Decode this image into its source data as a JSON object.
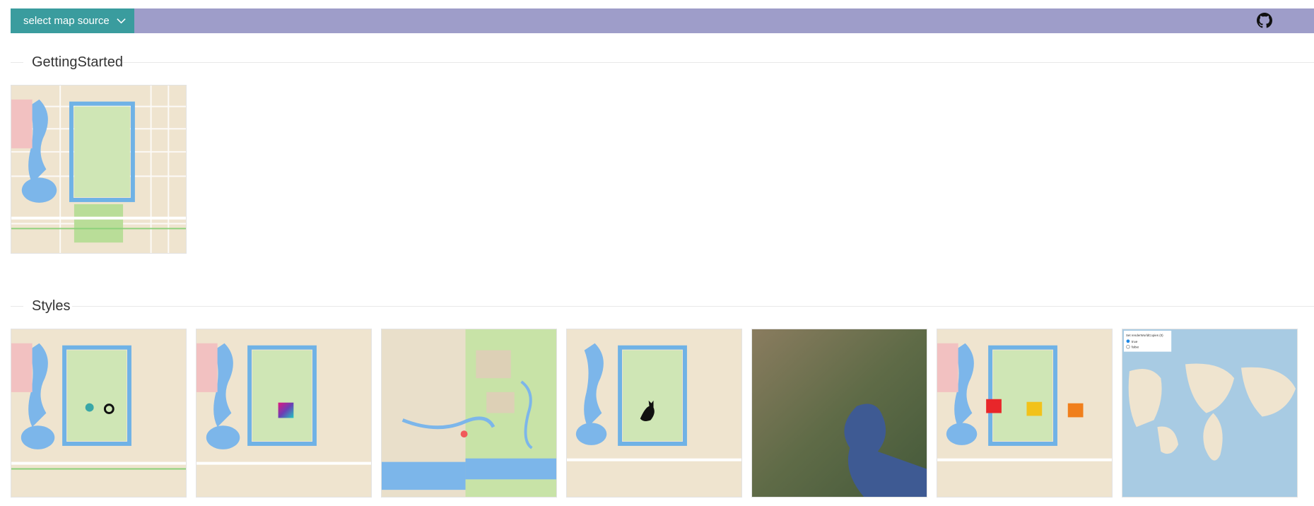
{
  "header": {
    "source_button_label": "select map source",
    "chevron_icon": "chevron-down-icon",
    "github_icon": "github-icon",
    "colors": {
      "bar": "#9e9dc9",
      "button": "#3a9c9e"
    }
  },
  "sections": [
    {
      "title": "GettingStarted",
      "items": [
        {
          "thumbnail": "beijing-street-map"
        }
      ]
    },
    {
      "title": "Styles",
      "items": [
        {
          "thumbnail": "beijing-map-with-markers"
        },
        {
          "thumbnail": "beijing-map-with-gradient-square"
        },
        {
          "thumbnail": "forbidden-city-zoomed-map"
        },
        {
          "thumbnail": "beijing-map-with-cat-icon"
        },
        {
          "thumbnail": "satellite-bohai-sea"
        },
        {
          "thumbnail": "beijing-map-with-colored-squares"
        },
        {
          "thumbnail": "world-map-with-radio-control"
        }
      ]
    }
  ],
  "world_map_control": {
    "title": "Set renderWorldCopies (0)",
    "options": [
      "true",
      "false"
    ],
    "selected": "true"
  }
}
